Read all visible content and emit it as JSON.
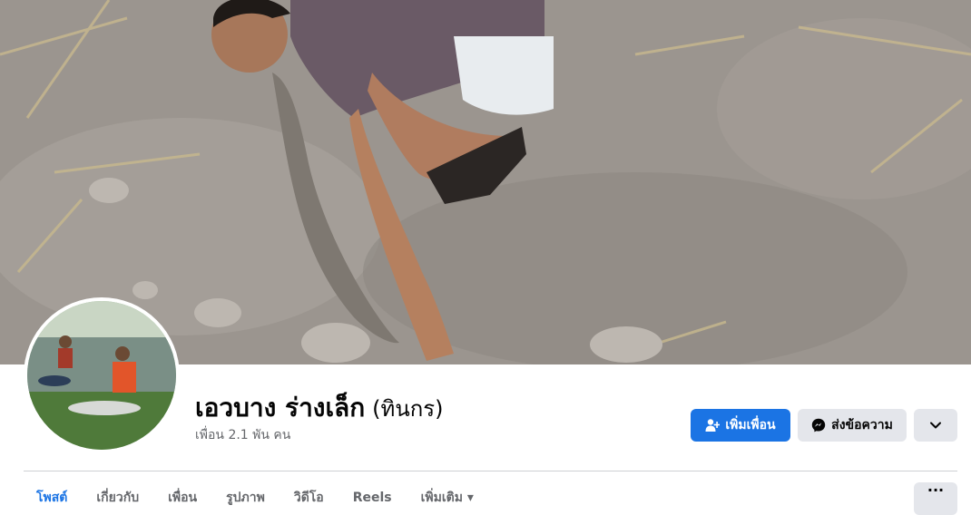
{
  "profile": {
    "name": "เอวบาง ร่างเล็ก",
    "alternate_name": "(ทินกร)",
    "friends_count": "เพื่อน 2.1 พัน คน"
  },
  "actions": {
    "add_friend": "เพิ่มเพื่อน",
    "message": "ส่งข้อความ",
    "more_icon": "chevron-down-icon"
  },
  "tabs": [
    {
      "label": "โพสต์"
    },
    {
      "label": "เกี่ยวกับ"
    },
    {
      "label": "เพื่อน"
    },
    {
      "label": "รูปภาพ"
    },
    {
      "label": "วิดีโอ"
    },
    {
      "label": "Reels"
    },
    {
      "label": "เพิ่มเติม ▾"
    }
  ],
  "tabs_more": "···",
  "colors": {
    "primary": "#1b74e4",
    "secondary_bg": "#e4e6eb",
    "muted_text": "#65676b"
  }
}
